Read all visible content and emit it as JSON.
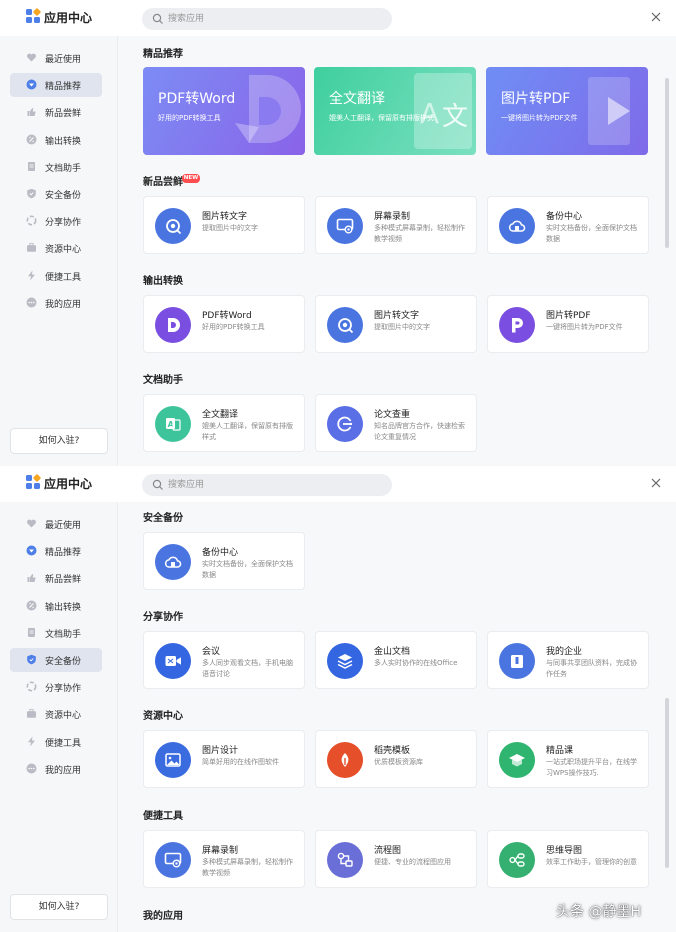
{
  "header": {
    "app_title": "应用中心",
    "search_placeholder": "搜索应用"
  },
  "sidebar": {
    "items": [
      {
        "label": "最近使用",
        "icon": "heart-icon"
      },
      {
        "label": "精品推荐",
        "icon": "diamond-icon"
      },
      {
        "label": "新品尝鲜",
        "icon": "thumb-up-icon"
      },
      {
        "label": "输出转换",
        "icon": "convert-icon"
      },
      {
        "label": "文档助手",
        "icon": "document-icon"
      },
      {
        "label": "安全备份",
        "icon": "shield-icon"
      },
      {
        "label": "分享协作",
        "icon": "share-icon"
      },
      {
        "label": "资源中心",
        "icon": "briefcase-icon"
      },
      {
        "label": "便捷工具",
        "icon": "lightning-icon"
      },
      {
        "label": "我的应用",
        "icon": "more-icon"
      }
    ],
    "join_label": "如何入驻?"
  },
  "panel1": {
    "active_index": 1,
    "featured": {
      "title": "精品推荐",
      "banners": [
        {
          "title": "PDF转Word",
          "subtitle": "好用的PDF转换工具"
        },
        {
          "title": "全文翻译",
          "subtitle": "媲美人工翻译，保留原有排版样式"
        },
        {
          "title": "图片转PDF",
          "subtitle": "一键将图片转为PDF文件"
        }
      ]
    },
    "sections": [
      {
        "title": "新品尝鲜",
        "badge": "NEW",
        "cards": [
          {
            "title": "图片转文字",
            "desc": "提取图片中的文字",
            "icon": "ocr-icon"
          },
          {
            "title": "屏幕录制",
            "desc": "多种模式屏幕录制，轻松制作教学视频",
            "icon": "screen-record-icon"
          },
          {
            "title": "备份中心",
            "desc": "实时文档备份，全面保护文档数据",
            "icon": "cloud-backup-icon"
          }
        ]
      },
      {
        "title": "输出转换",
        "cards": [
          {
            "title": "PDF转Word",
            "desc": "好用的PDF转换工具",
            "icon": "pdf-to-word-icon"
          },
          {
            "title": "图片转文字",
            "desc": "提取图片中的文字",
            "icon": "ocr-icon"
          },
          {
            "title": "图片转PDF",
            "desc": "一键将图片转为PDF文件",
            "icon": "image-to-pdf-icon"
          }
        ]
      },
      {
        "title": "文档助手",
        "cards": [
          {
            "title": "全文翻译",
            "desc": "媲美人工翻译，保留原有排版样式",
            "icon": "translate-icon"
          },
          {
            "title": "论文查重",
            "desc": "知名品牌官方合作，快速检索论文重复情况",
            "icon": "plagiarism-check-icon"
          }
        ]
      }
    ]
  },
  "panel2": {
    "active_index": 5,
    "sections": [
      {
        "title": "安全备份",
        "cards": [
          {
            "title": "备份中心",
            "desc": "实时文档备份，全面保护文档数据",
            "icon": "cloud-backup-icon"
          }
        ]
      },
      {
        "title": "分享协作",
        "cards": [
          {
            "title": "会议",
            "desc": "多人同步观看文档，手机电脑语音讨论",
            "icon": "meeting-icon"
          },
          {
            "title": "金山文档",
            "desc": "多人实时协作的在线Office",
            "icon": "kdocs-icon"
          },
          {
            "title": "我的企业",
            "desc": "与同事共享团队资料，完成协作任务",
            "icon": "enterprise-icon"
          }
        ]
      },
      {
        "title": "资源中心",
        "cards": [
          {
            "title": "图片设计",
            "desc": "简单好用的在线作图软件",
            "icon": "image-design-icon"
          },
          {
            "title": "稻壳模板",
            "desc": "优质模板资源库",
            "icon": "docer-template-icon"
          },
          {
            "title": "精品课",
            "desc": "一站式职场提升平台，在线学习WPS操作技巧.",
            "icon": "course-icon"
          }
        ]
      },
      {
        "title": "便捷工具",
        "cards": [
          {
            "title": "屏幕录制",
            "desc": "多种模式屏幕录制，轻松制作教学视频",
            "icon": "screen-record-icon"
          },
          {
            "title": "流程图",
            "desc": "便捷、专业的流程图应用",
            "icon": "flowchart-icon"
          },
          {
            "title": "思维导图",
            "desc": "效率工作助手，管理你的创意",
            "icon": "mindmap-icon"
          }
        ]
      },
      {
        "title": "我的应用",
        "cards": []
      }
    ]
  },
  "watermark": "头条 @静墨H",
  "colors": {
    "accent": "#4e7ee8",
    "banner_pdf": "#7b6cf0",
    "banner_translate": "#4fd1a4",
    "banner_image_pdf": "#5b86f2",
    "new_badge": "#ff4d4f"
  }
}
